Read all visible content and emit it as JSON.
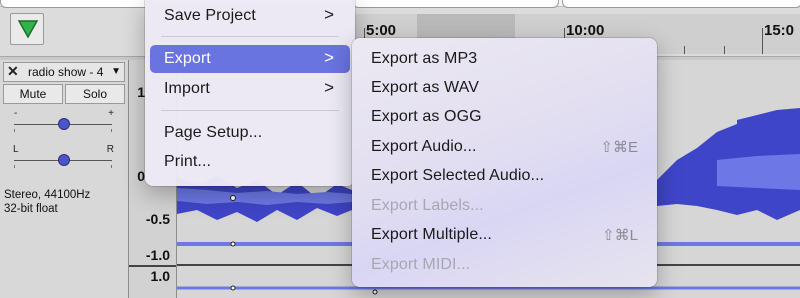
{
  "toolbar": {
    "play_icon": "play-triangle-icon"
  },
  "timeline": {
    "labels": [
      "5:00",
      "10:00",
      "15:0"
    ]
  },
  "track": {
    "close_icon": "close-icon",
    "name": "radio show - 4",
    "dropdown_icon": "dropdown-caret-icon",
    "mute_label": "Mute",
    "solo_label": "Solo",
    "gain_minus": "-",
    "gain_plus": "+",
    "pan_left": "L",
    "pan_right": "R",
    "info_line1": "Stereo, 44100Hz",
    "info_line2": "32-bit float"
  },
  "scale": {
    "labels": [
      "1",
      "0",
      "-0.5",
      "-1.0",
      "1.0"
    ]
  },
  "file_menu": {
    "items": [
      {
        "label": "Save Project",
        "submenu_arrow": ">"
      },
      {
        "label": "Export",
        "submenu_arrow": ">"
      },
      {
        "label": "Import",
        "submenu_arrow": ">"
      },
      {
        "label": "Page Setup..."
      },
      {
        "label": "Print..."
      }
    ]
  },
  "export_menu": {
    "items": [
      {
        "label": "Export as MP3",
        "enabled": true
      },
      {
        "label": "Export as WAV",
        "enabled": true
      },
      {
        "label": "Export as OGG",
        "enabled": true
      },
      {
        "label": "Export Audio...",
        "shortcut": "⇧⌘E",
        "enabled": true
      },
      {
        "label": "Export Selected Audio...",
        "enabled": true
      },
      {
        "label": "Export Labels...",
        "enabled": false
      },
      {
        "label": "Export Multiple...",
        "shortcut": "⇧⌘L",
        "enabled": true
      },
      {
        "label": "Export MIDI...",
        "enabled": false
      }
    ]
  },
  "colors": {
    "highlight": "#6a74e0",
    "waveform": "#3f45c8",
    "waveform_rms": "#6d78e6",
    "play_green": "#2fb34a"
  }
}
